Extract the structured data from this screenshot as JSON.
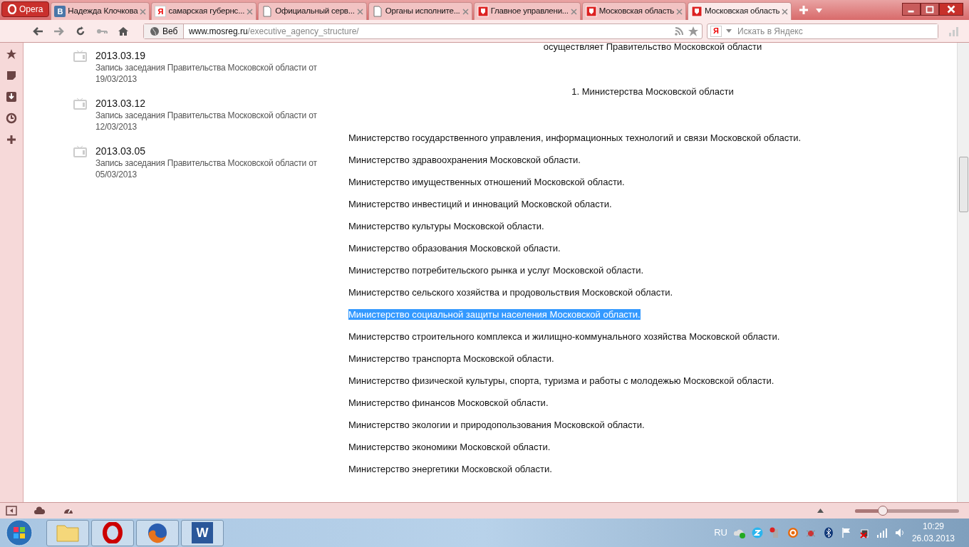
{
  "browser": {
    "menu_button": "Opera",
    "tabs": [
      {
        "label": "Надежда Клочкова",
        "kind": "vk",
        "icon_text": "В",
        "selected": false
      },
      {
        "label": "самарская губернс...",
        "kind": "yandex",
        "icon_text": "Я",
        "selected": false
      },
      {
        "label": "Официальный серв...",
        "kind": "page",
        "selected": false
      },
      {
        "label": "Органы исполните...",
        "kind": "page",
        "selected": false
      },
      {
        "label": "Главное управлени...",
        "kind": "coat",
        "selected": false
      },
      {
        "label": "Московская область",
        "kind": "coat",
        "selected": false
      },
      {
        "label": "Московская область",
        "kind": "coat",
        "selected": true
      }
    ],
    "address": {
      "badge": "Веб",
      "host": "www.mosreg.ru",
      "path": "/executive_agency_structure/"
    },
    "search": {
      "engine_letter": "Я",
      "placeholder": "Искать в Яндекс"
    },
    "zoom": {
      "level": 0.27
    }
  },
  "news": [
    {
      "date": "2013.03.19",
      "text": "Запись заседания Правительства Московской области от 19/03/2013"
    },
    {
      "date": "2013.03.12",
      "text": "Запись заседания Правительства Московской области от 12/03/2013"
    },
    {
      "date": "2013.03.05",
      "text": "Запись заседания Правительства Московской области от 05/03/2013"
    }
  ],
  "article": {
    "intro_tail": "осуществляет Правительство Московской области",
    "heading": "1. Министерства Московской области",
    "ministries": [
      {
        "text": "Министерство государственного управления, информационных технологий и связи Московской области.",
        "selected": false
      },
      {
        "text": "Министерство здравоохранения Московской области.",
        "selected": false
      },
      {
        "text": "Министерство имущественных отношений Московской области.",
        "selected": false
      },
      {
        "text": "Министерство инвестиций и инноваций Московской области.",
        "selected": false
      },
      {
        "text": "Министерство культуры Московской области.",
        "selected": false
      },
      {
        "text": "Министерство образования Московской области.",
        "selected": false
      },
      {
        "text": "Министерство потребительского рынка и услуг Московской области.",
        "selected": false
      },
      {
        "text": "Министерство сельского хозяйства и продовольствия Московской области.",
        "selected": false
      },
      {
        "text": "Министерство социальной защиты населения Московской области.",
        "selected": true
      },
      {
        "text": "Министерство строительного комплекса и жилищно-коммунального хозяйства Московской области.",
        "selected": false
      },
      {
        "text": "Министерство транспорта Московской области.",
        "selected": false
      },
      {
        "text": "Министерство физической культуры, спорта, туризма и работы с молодежью Московской области.",
        "selected": false
      },
      {
        "text": "Министерство финансов Московской области.",
        "selected": false
      },
      {
        "text": "Министерство экологии и природопользования Московской области.",
        "selected": false
      },
      {
        "text": "Министерство экономики Московской области.",
        "selected": false
      },
      {
        "text": "Министерство энергетики Московской области.",
        "selected": false
      }
    ]
  },
  "taskbar": {
    "apps": [
      {
        "kind": "explorer"
      },
      {
        "kind": "opera"
      },
      {
        "kind": "firefox"
      },
      {
        "kind": "word",
        "letter": "W"
      }
    ],
    "language": "RU",
    "time": "10:29",
    "date": "26.03.2013"
  }
}
